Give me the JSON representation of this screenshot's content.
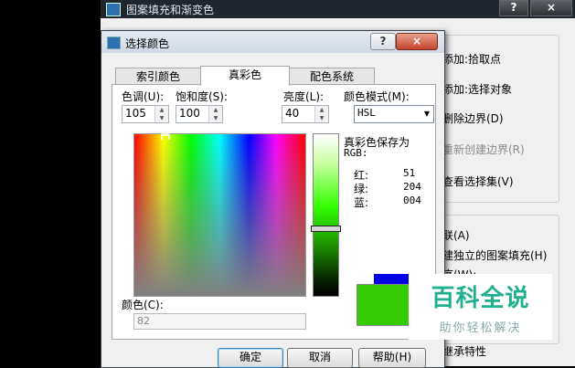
{
  "background_window": {
    "title": "图案填充和渐变色",
    "title_buttons": {
      "help": "?",
      "close": "×"
    },
    "items": [
      {
        "label": "添加:拾取点",
        "enabled": true
      },
      {
        "label": "添加:选择对象",
        "enabled": true
      },
      {
        "label": "删除边界(D)",
        "enabled": true
      },
      {
        "label": "重新创建边界(R)",
        "enabled": false
      },
      {
        "label": "查看选择集(V)",
        "enabled": true
      }
    ],
    "options_fragment": "联(A)",
    "independent_hatch": "建独立的图案填充(H)",
    "order_fragment": "序(W):",
    "inherit": "继承特性"
  },
  "dialog": {
    "title": "选择颜色",
    "title_buttons": {
      "help": "?",
      "close": "×"
    },
    "tabs": [
      {
        "label": "索引颜色",
        "active": false
      },
      {
        "label": "真彩色",
        "active": true
      },
      {
        "label": "配色系统",
        "active": false
      }
    ],
    "hue": {
      "label": "色调(U):",
      "value": "105"
    },
    "saturation": {
      "label": "饱和度(S):",
      "value": "100"
    },
    "luminance": {
      "label": "亮度(L):",
      "value": "40"
    },
    "color_mode": {
      "label": "颜色模式(M):",
      "value": "HSL"
    },
    "rgb_info": {
      "heading": "真彩色保存为",
      "subheading": "RGB:",
      "red_label": "红:",
      "red_value": "51",
      "green_label": "绿:",
      "green_value": "204",
      "blue_label": "蓝:",
      "blue_value": "004"
    },
    "color_field": {
      "label": "颜色(C):",
      "value": "82"
    },
    "buttons": {
      "ok": "确定",
      "cancel": "取消",
      "help": "帮助(H)"
    },
    "swatch_colors": {
      "previous": "#0000e6",
      "current": "#33cc04"
    }
  },
  "watermark": {
    "title": "百科全说",
    "subtitle": "助你轻松解决"
  }
}
